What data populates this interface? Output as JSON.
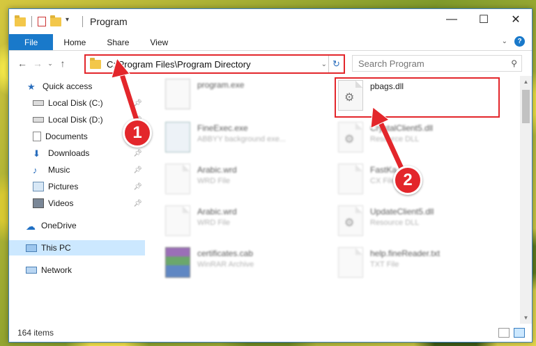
{
  "window": {
    "title": "Program",
    "controls": {
      "minimize": "—",
      "maximize": "☐",
      "close": "✕"
    }
  },
  "ribbon": {
    "tabs": [
      "File",
      "Home",
      "Share",
      "View"
    ],
    "expand_icon": "chevron-down-icon",
    "help_label": "?"
  },
  "address_bar": {
    "path": "C:\\Program Files\\Program Directory"
  },
  "search": {
    "placeholder": "Search Program"
  },
  "sidebar": {
    "items": [
      {
        "label": "Quick access",
        "icon": "star-icon",
        "pinned": false
      },
      {
        "label": "Local Disk (C:)",
        "icon": "drive-icon",
        "pinned": true
      },
      {
        "label": "Local Disk (D:)",
        "icon": "drive-icon",
        "pinned": true
      },
      {
        "label": "Documents",
        "icon": "documents-icon",
        "pinned": true
      },
      {
        "label": "Downloads",
        "icon": "download-icon",
        "pinned": true
      },
      {
        "label": "Music",
        "icon": "music-icon",
        "pinned": true
      },
      {
        "label": "Pictures",
        "icon": "pictures-icon",
        "pinned": true
      },
      {
        "label": "Videos",
        "icon": "videos-icon",
        "pinned": true
      },
      {
        "label": "OneDrive",
        "icon": "cloud-icon",
        "pinned": false
      },
      {
        "label": "This PC",
        "icon": "computer-icon",
        "pinned": false,
        "selected": true
      },
      {
        "label": "Network",
        "icon": "network-icon",
        "pinned": false
      }
    ]
  },
  "files": [
    {
      "name": "program.exe",
      "type": "",
      "icon": "exe-icon",
      "blurred": true
    },
    {
      "name": "pbags.dll",
      "type": "",
      "icon": "dll-gear-icon",
      "blurred": false,
      "highlighted": true
    },
    {
      "name": "FineExec.exe",
      "type": "ABBYY background exe...",
      "icon": "exe-icon",
      "blurred": true
    },
    {
      "name": "CrystalClient5.dll",
      "type": "Resource DLL",
      "icon": "dll-gear-icon",
      "blurred": true
    },
    {
      "name": "Arabic.wrd",
      "type": "WRD File",
      "icon": "file-icon",
      "blurred": true
    },
    {
      "name": "FastKa.nk",
      "type": "CX File",
      "icon": "file-icon",
      "blurred": true
    },
    {
      "name": "Arabic.wrd",
      "type": "WRD File",
      "icon": "file-icon",
      "blurred": true
    },
    {
      "name": "UpdateClient5.dll",
      "type": "Resource DLL",
      "icon": "dll-gear-icon",
      "blurred": true
    },
    {
      "name": "certificates.cab",
      "type": "WinRAR Archive",
      "icon": "archive-icon",
      "blurred": true
    },
    {
      "name": "help.fineReader.txt",
      "type": "TXT File",
      "icon": "file-icon",
      "blurred": true
    }
  ],
  "status": {
    "item_count": "164 items"
  },
  "annotations": {
    "badge1": "1",
    "badge2": "2",
    "accent": "#e3262b"
  }
}
